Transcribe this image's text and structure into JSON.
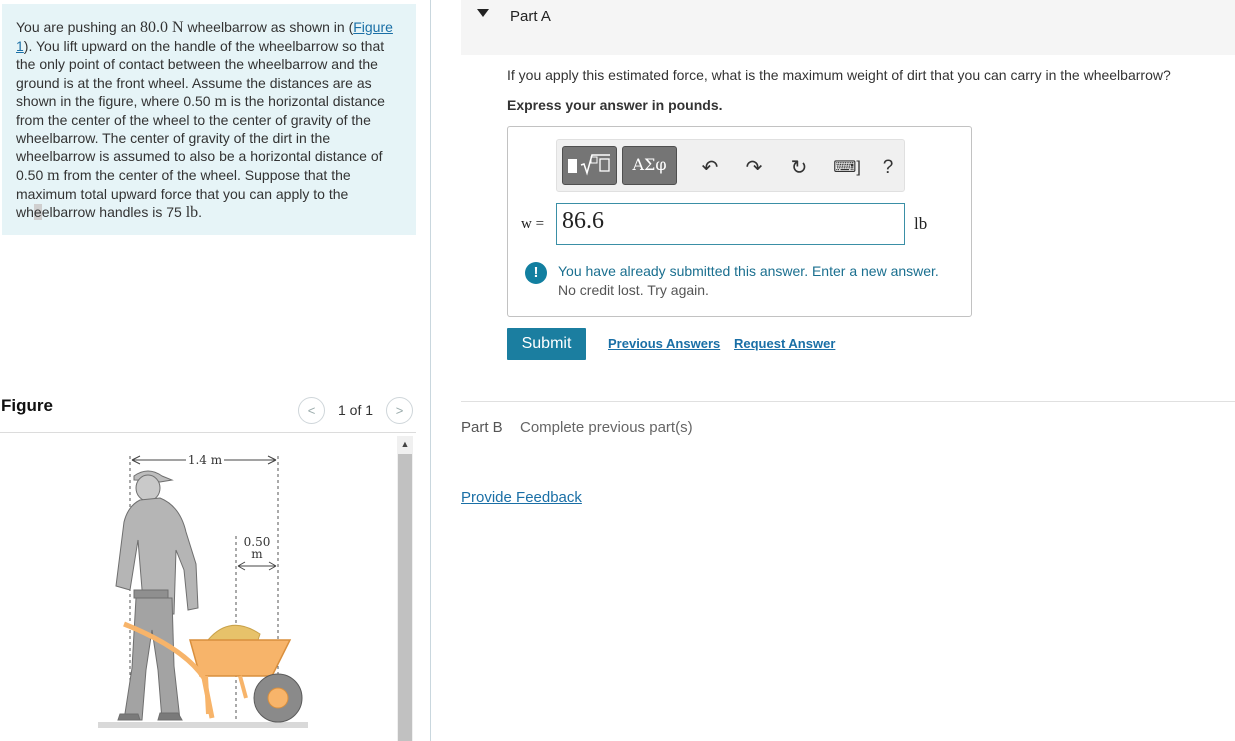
{
  "problem": {
    "t1": "You are pushing an ",
    "weight_value": "80.0 ",
    "weight_unit": "N",
    "t2": " wheelbarrow as shown in (",
    "figure_link": "Figure 1",
    "t3": "). You lift upward on the handle of the wheelbarrow so that the only point of contact between the wheelbarrow and the ground is at the front wheel. Assume the distances are as shown in the figure, where 0.50 ",
    "m1": "m",
    "t4": " is the horizontal distance from the center of the wheel to the center of gravity of the wheelbarrow. The center of gravity of the dirt in the wheelbarrow is assumed to also be a horizontal distance of 0.50 ",
    "m2": "m",
    "t5": " from the center of the wheel. Suppose that the maximum total upward force that you can apply to the wh",
    "hl": "e",
    "t6": "elbarrow handles is 75 ",
    "unit_lb": "lb",
    "t7": "."
  },
  "figure": {
    "label": "Figure",
    "nav_prev": "<",
    "nav_next": ">",
    "count": "1 of 1",
    "dim_long": "1.4 m",
    "dim_short_value": "0.50",
    "dim_short_unit": "m"
  },
  "part_a": {
    "title": "Part A",
    "question": "If you apply this estimated force, what is the maximum weight of dirt that you can carry in the wheelbarrow?",
    "instruction": "Express your answer in pounds.",
    "toolbar": {
      "greek": "ΑΣφ",
      "undo": "↶",
      "redo": "↷",
      "reset": "↻",
      "keyboard": "⌨]",
      "help": "?"
    },
    "variable": "w =",
    "answer": "86.6",
    "unit": "lb",
    "feedback_line1": "You have already submitted this answer. Enter a new answer.",
    "feedback_line2": "No credit lost. Try again.",
    "feedback_icon": "!",
    "submit": "Submit",
    "previous_answers": "Previous Answers",
    "request_answer": "Request Answer"
  },
  "part_b": {
    "label": "Part B",
    "status": "Complete previous part(s)"
  },
  "provide_feedback": "Provide Feedback",
  "colors": {
    "problem_bg": "#e6f4f7",
    "accent": "#1b7ea0",
    "link": "#1a6fa6",
    "wheelbarrow": "#f7b46a"
  }
}
